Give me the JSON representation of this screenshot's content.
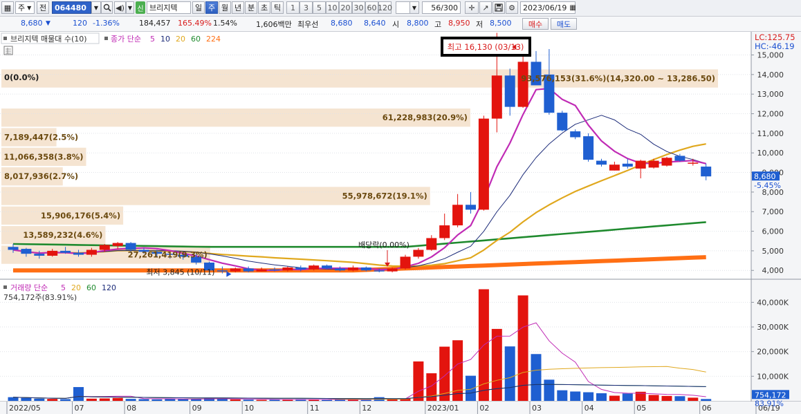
{
  "toolbar": {
    "market_label": "주",
    "jeon_label": "전",
    "code": "064480",
    "shin_badge": "신",
    "stock_name": "브리지텍",
    "periods": [
      "일",
      "주",
      "월",
      "년",
      "분",
      "초",
      "틱"
    ],
    "selected_period": "주",
    "intervals": [
      "1",
      "3",
      "5",
      "10",
      "20",
      "30",
      "60",
      "120"
    ],
    "count": "56/300",
    "date": "2023/06/19"
  },
  "quote": {
    "price": "8,680",
    "arrow": "▼",
    "change": "120",
    "change_pct": "-1.36%",
    "volume": "184,457",
    "volume_ratio": "165.49%",
    "turnover": "1.54%",
    "amount": "1,606백만",
    "best_label": "최우선",
    "ask": "8,680",
    "bid": "8,640",
    "open_label": "시",
    "open": "8,800",
    "high_label": "고",
    "high": "8,950",
    "low_label": "저",
    "low": "8,500",
    "buy_label": "매수",
    "sell_label": "매도"
  },
  "chart_data": [
    {
      "type": "candlestick",
      "title": "브리지텍 매물대 수(10)",
      "ma_title": "종가 단순",
      "ma_periods": [
        "5",
        "10",
        "20",
        "60",
        "224"
      ],
      "ma_colors": [
        "#c02bb5",
        "#1b2a78",
        "#e0a81e",
        "#1f8a2e",
        "#ff6f14"
      ],
      "up_color": "#e3140e",
      "down_color": "#1f5fd1",
      "y_ticks": [
        "15,000",
        "14,000",
        "13,000",
        "12,000",
        "11,000",
        "10,000",
        "9,000",
        "8,000",
        "7,000",
        "6,000",
        "5,000",
        "4,000"
      ],
      "y_tick_values": [
        15000,
        14000,
        13000,
        12000,
        11000,
        10000,
        9000,
        8000,
        7000,
        6000,
        5000,
        4000
      ],
      "ylim": [
        3550,
        15900
      ],
      "lc_label": "LC:125.75",
      "hc_label": "HC:-46.19",
      "last_price_label": "8,680",
      "last_change_label": "-5.45%",
      "high_annotation": "최고 16,130 (03/13)",
      "low_annotation": "최저 3,845 (10/11)",
      "dividend_annotation": "배당락(0.00%)",
      "candles": [
        {
          "o": 5200,
          "h": 5350,
          "l": 4900,
          "c": 5050
        },
        {
          "o": 5100,
          "h": 5150,
          "l": 4700,
          "c": 4850
        },
        {
          "o": 4850,
          "h": 5000,
          "l": 4600,
          "c": 4750
        },
        {
          "o": 4750,
          "h": 5100,
          "l": 4700,
          "c": 5000
        },
        {
          "o": 5000,
          "h": 5200,
          "l": 4850,
          "c": 4900
        },
        {
          "o": 4900,
          "h": 5050,
          "l": 4700,
          "c": 4800
        },
        {
          "o": 4800,
          "h": 5150,
          "l": 4700,
          "c": 5050
        },
        {
          "o": 5050,
          "h": 5350,
          "l": 4950,
          "c": 5300
        },
        {
          "o": 5250,
          "h": 5450,
          "l": 5100,
          "c": 5400
        },
        {
          "o": 5400,
          "h": 5450,
          "l": 4950,
          "c": 5050
        },
        {
          "o": 5050,
          "h": 5150,
          "l": 4850,
          "c": 4950
        },
        {
          "o": 4950,
          "h": 5050,
          "l": 4700,
          "c": 4850
        },
        {
          "o": 4850,
          "h": 4950,
          "l": 4600,
          "c": 4800
        },
        {
          "o": 4800,
          "h": 4900,
          "l": 4550,
          "c": 4700
        },
        {
          "o": 4700,
          "h": 4850,
          "l": 4300,
          "c": 4400
        },
        {
          "o": 4400,
          "h": 4450,
          "l": 3900,
          "c": 4000
        },
        {
          "o": 4000,
          "h": 4200,
          "l": 3845,
          "c": 3950
        },
        {
          "o": 3950,
          "h": 4150,
          "l": 3900,
          "c": 4100
        },
        {
          "o": 4100,
          "h": 4200,
          "l": 3900,
          "c": 3950
        },
        {
          "o": 3950,
          "h": 4150,
          "l": 3950,
          "c": 4050
        },
        {
          "o": 4050,
          "h": 4150,
          "l": 3950,
          "c": 4000
        },
        {
          "o": 4000,
          "h": 4200,
          "l": 3950,
          "c": 4150
        },
        {
          "o": 4150,
          "h": 4250,
          "l": 3950,
          "c": 4050
        },
        {
          "o": 4050,
          "h": 4300,
          "l": 4000,
          "c": 4250
        },
        {
          "o": 4250,
          "h": 4300,
          "l": 4050,
          "c": 4100
        },
        {
          "o": 4100,
          "h": 4200,
          "l": 3950,
          "c": 4000
        },
        {
          "o": 4000,
          "h": 4250,
          "l": 3950,
          "c": 4150
        },
        {
          "o": 4150,
          "h": 4200,
          "l": 3950,
          "c": 4000
        },
        {
          "o": 4000,
          "h": 4100,
          "l": 3900,
          "c": 3950
        },
        {
          "o": 3950,
          "h": 4150,
          "l": 3900,
          "c": 4100
        },
        {
          "o": 4100,
          "h": 4800,
          "l": 4050,
          "c": 4700
        },
        {
          "o": 4700,
          "h": 5150,
          "l": 4600,
          "c": 5050
        },
        {
          "o": 5050,
          "h": 5800,
          "l": 5000,
          "c": 5650
        },
        {
          "o": 5650,
          "h": 6900,
          "l": 5550,
          "c": 6300
        },
        {
          "o": 6300,
          "h": 7900,
          "l": 6200,
          "c": 7350
        },
        {
          "o": 7350,
          "h": 8000,
          "l": 6900,
          "c": 7100
        },
        {
          "o": 7100,
          "h": 11900,
          "l": 7050,
          "c": 11750
        },
        {
          "o": 11750,
          "h": 16130,
          "l": 11050,
          "c": 13950
        },
        {
          "o": 13950,
          "h": 14300,
          "l": 11900,
          "c": 12350
        },
        {
          "o": 12350,
          "h": 15800,
          "l": 12300,
          "c": 14650
        },
        {
          "o": 14650,
          "h": 15200,
          "l": 14400,
          "c": 13450
        },
        {
          "o": 14000,
          "h": 15300,
          "l": 11950,
          "c": 12050
        },
        {
          "o": 12050,
          "h": 12150,
          "l": 11100,
          "c": 11150
        },
        {
          "o": 11100,
          "h": 11200,
          "l": 10700,
          "c": 10800
        },
        {
          "o": 10850,
          "h": 11000,
          "l": 9550,
          "c": 9650
        },
        {
          "o": 9600,
          "h": 9700,
          "l": 9300,
          "c": 9400
        },
        {
          "o": 9100,
          "h": 9550,
          "l": 9100,
          "c": 9400
        },
        {
          "o": 9450,
          "h": 9700,
          "l": 9200,
          "c": 9300
        },
        {
          "o": 9200,
          "h": 9650,
          "l": 8700,
          "c": 9600
        },
        {
          "o": 9250,
          "h": 9700,
          "l": 9200,
          "c": 9600
        },
        {
          "o": 9350,
          "h": 9800,
          "l": 9300,
          "c": 9750
        },
        {
          "o": 9850,
          "h": 9950,
          "l": 9550,
          "c": 9600
        },
        {
          "o": 9450,
          "h": 9700,
          "l": 9350,
          "c": 9500
        },
        {
          "o": 9300,
          "h": 9450,
          "l": 8600,
          "c": 8800
        }
      ],
      "volume_profile": [
        {
          "label": "0(0.0%)",
          "price_low": 13400,
          "price_high": 14300,
          "volume": 0
        },
        {
          "label": "93,576,153(31.6%)(14,320.00 ~ 13,286.50)",
          "price_low": 13300,
          "price_high": 14300,
          "volume": 93576153
        },
        {
          "label": "61,228,983(20.9%)",
          "price_low": 11300,
          "price_high": 12300,
          "volume": 61228983
        },
        {
          "label": "7,189,447(2.5%)",
          "price_low": 10300,
          "price_high": 11300,
          "volume": 7189447
        },
        {
          "label": "11,066,358(3.8%)",
          "price_low": 9300,
          "price_high": 10300,
          "volume": 11066358
        },
        {
          "label": "8,017,936(2.7%)",
          "price_low": 8300,
          "price_high": 9300,
          "volume": 8017936
        },
        {
          "label": "55,978,672(19.1%)",
          "price_low": 7300,
          "price_high": 8300,
          "volume": 55978672
        },
        {
          "label": "15,906,176(5.4%)",
          "price_low": 6300,
          "price_high": 7300,
          "volume": 15906176
        },
        {
          "label": "13,589,232(4.6%)",
          "price_low": 5300,
          "price_high": 6300,
          "volume": 13589232
        },
        {
          "label": "27,261,419(9.3%)",
          "price_low": 4300,
          "price_high": 5300,
          "volume": 27261419
        }
      ],
      "x_ticks": [
        {
          "i": 0,
          "label": "2022/05"
        },
        {
          "i": 5,
          "label": "07"
        },
        {
          "i": 9,
          "label": "08"
        },
        {
          "i": 14,
          "label": "09"
        },
        {
          "i": 18,
          "label": "10"
        },
        {
          "i": 23,
          "label": "11"
        },
        {
          "i": 27,
          "label": "12"
        },
        {
          "i": 32,
          "label": "2023/01"
        },
        {
          "i": 36,
          "label": "02"
        },
        {
          "i": 40,
          "label": "03"
        },
        {
          "i": 44,
          "label": "04"
        },
        {
          "i": 48,
          "label": "05"
        },
        {
          "i": 53,
          "label": "06"
        },
        {
          "i": 57,
          "label": "06/19"
        }
      ]
    },
    {
      "type": "bar",
      "title": "거래량 단순",
      "ma_periods": [
        "5",
        "20",
        "60",
        "120"
      ],
      "ma_colors": [
        "#c02bb5",
        "#e0a81e",
        "#1f8a2e",
        "#1b2a78"
      ],
      "volume_label": "754,172주(83.91%)",
      "y_ticks": [
        "40,000K",
        "30,000K",
        "20,000K",
        "10,000K"
      ],
      "y_tick_values": [
        40000,
        30000,
        20000,
        10000
      ],
      "ylim": [
        0,
        46000
      ],
      "last_volume_label": "754,172",
      "last_ratio_label": "83.91%",
      "values": [
        1500,
        1200,
        900,
        800,
        700,
        5600,
        900,
        1000,
        1200,
        800,
        700,
        600,
        900,
        800,
        700,
        1100,
        900,
        600,
        500,
        400,
        500,
        600,
        700,
        500,
        400,
        600,
        500,
        400,
        1500,
        600,
        1000,
        16000,
        11200,
        22000,
        24600,
        10200,
        45300,
        29200,
        22100,
        42800,
        19000,
        8600,
        4300,
        3800,
        3500,
        3100,
        2100,
        3000,
        3700,
        2400,
        2000,
        1900,
        1300,
        754
      ]
    }
  ]
}
